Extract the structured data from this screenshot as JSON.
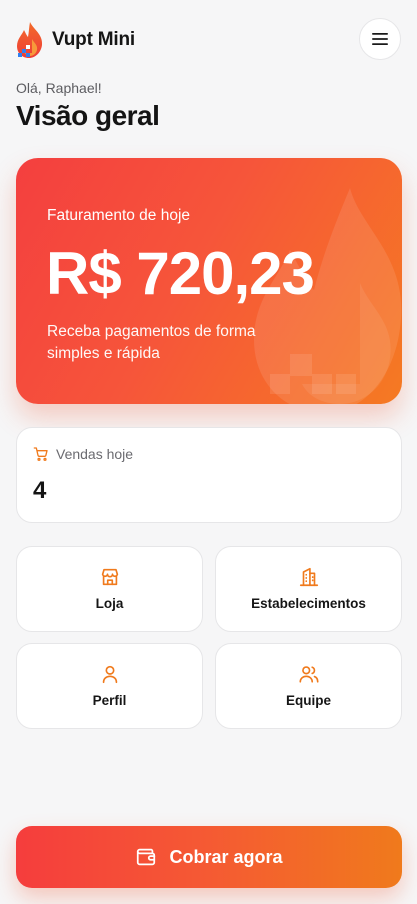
{
  "brand": {
    "name": "Vupt Mini",
    "accent": "#f5523a"
  },
  "header": {
    "greeting": "Olá, Raphael!",
    "title": "Visão geral"
  },
  "revenue": {
    "label": "Faturamento de hoje",
    "value": "R$ 720,23",
    "description": "Receba pagamentos de forma simples e rápida"
  },
  "sales": {
    "label": "Vendas hoje",
    "value": "4",
    "icon": "cart-icon"
  },
  "tiles": [
    {
      "label": "Loja",
      "icon": "store-icon"
    },
    {
      "label": "Estabelecimentos",
      "icon": "building-icon"
    },
    {
      "label": "Perfil",
      "icon": "user-icon"
    },
    {
      "label": "Equipe",
      "icon": "users-icon"
    }
  ],
  "cta": {
    "label": "Cobrar agora",
    "icon": "wallet-icon"
  }
}
